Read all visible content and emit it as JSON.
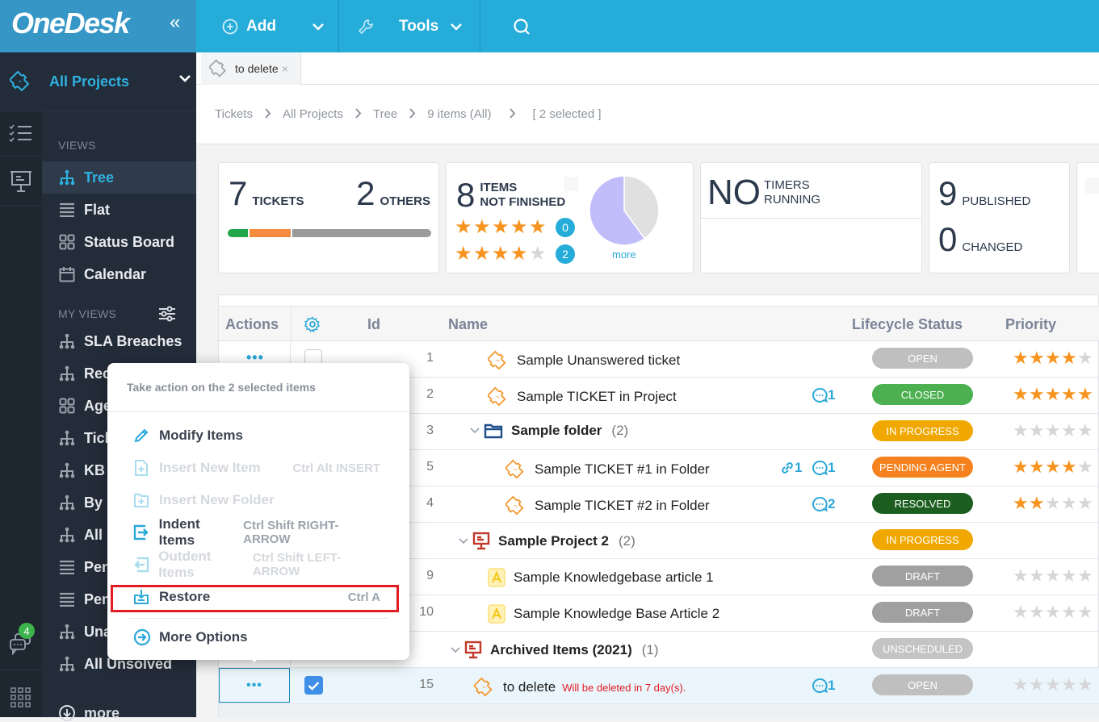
{
  "app": {
    "logo": "OneDesk",
    "collapse_icon": "«"
  },
  "toolbar": {
    "add_label": "Add",
    "tools_label": "Tools"
  },
  "rail": {
    "chat_badge": "4"
  },
  "sidebar": {
    "project": "All Projects",
    "views_label": "VIEWS",
    "views": [
      {
        "label": "Tree",
        "icon": "tree-icon",
        "active": true
      },
      {
        "label": "Flat",
        "icon": "list-icon"
      },
      {
        "label": "Status Board",
        "icon": "board-icon"
      },
      {
        "label": "Calendar",
        "icon": "calendar-icon"
      }
    ],
    "my_views_label": "MY VIEWS",
    "my_views": [
      {
        "label": "SLA Breaches",
        "icon": "tree-icon"
      },
      {
        "label": "Rec",
        "icon": "tree-icon"
      },
      {
        "label": "Age",
        "icon": "board-icon"
      },
      {
        "label": "Tick",
        "icon": "tree-icon"
      },
      {
        "label": "KB",
        "icon": "tree-icon"
      },
      {
        "label": "By I",
        "icon": "tree-icon"
      },
      {
        "label": "All I",
        "icon": "tree-icon"
      },
      {
        "label": "Pen",
        "icon": "list-icon"
      },
      {
        "label": "Pen",
        "icon": "list-icon"
      },
      {
        "label": "Una",
        "icon": "tree-icon"
      },
      {
        "label": "All Unsolved",
        "icon": "tree-icon"
      }
    ],
    "more_label": "more"
  },
  "tab": {
    "label": "to delete",
    "close": "×"
  },
  "breadcrumb": [
    "Tickets",
    "All Projects",
    "Tree",
    "9 items (All)",
    "[ 2 selected ]"
  ],
  "cards": {
    "tickets": {
      "count": "7",
      "label": "TICKETS",
      "others_count": "2",
      "others_label": "OTHERS"
    },
    "progress": {
      "green": 0.1,
      "orange": 0.21,
      "gray": 0.69
    },
    "not_finished": {
      "count": "8",
      "line1": "ITEMS",
      "line2": "NOT FINISHED",
      "five_star_count": "0",
      "four_star_count": "2",
      "more_label": "more",
      "pie": {
        "purple": 0.6,
        "gray": 0.4
      }
    },
    "timers": {
      "big": "NO",
      "line1": "TIMERS",
      "line2": "RUNNING"
    },
    "publish": {
      "published_count": "9",
      "published_label": "PUBLISHED",
      "changed_count": "0",
      "changed_label": "CHANGED"
    }
  },
  "grid": {
    "headers": {
      "actions": "Actions",
      "id": "Id",
      "name": "Name",
      "status": "Lifecycle Status",
      "priority": "Priority"
    },
    "rows": [
      {
        "id": "1",
        "name": "Sample Unanswered ticket",
        "type": "ticket",
        "indent": 0,
        "status": "OPEN",
        "status_color": "#bfbfbf",
        "stars": 4,
        "comments": ""
      },
      {
        "id": "2",
        "name": "Sample TICKET in Project",
        "type": "ticket",
        "indent": 0,
        "status": "CLOSED",
        "status_color": "#4caf50",
        "stars": 5,
        "comments": "1"
      },
      {
        "id": "3",
        "name": "Sample folder",
        "count": "(2)",
        "type": "folder",
        "indent": 0,
        "status": "IN PROGRESS",
        "status_color": "#f0a800",
        "stars": 0,
        "comments": ""
      },
      {
        "id": "5",
        "name": "Sample TICKET #1 in Folder",
        "type": "ticket",
        "indent": 1,
        "status": "PENDING AGENT",
        "status_color": "#f5821f",
        "stars": 4,
        "links": "1",
        "comments": "1"
      },
      {
        "id": "4",
        "name": "Sample TICKET #2 in Folder",
        "type": "ticket",
        "indent": 1,
        "status": "RESOLVED",
        "status_color": "#1b5e20",
        "stars": 2,
        "comments": "2"
      },
      {
        "id": "",
        "name": "Sample Project 2",
        "count": "(2)",
        "type": "project",
        "indent": 0,
        "status": "IN PROGRESS",
        "status_color": "#f0a800",
        "stars": null,
        "comments": ""
      },
      {
        "id": "9",
        "name": "Sample Knowledgebase article 1",
        "type": "article",
        "indent": 0,
        "status": "DRAFT",
        "status_color": "#a0a0a0",
        "stars": 0,
        "comments": ""
      },
      {
        "id": "10",
        "name": "Sample Knowledge Base Article 2",
        "type": "article",
        "indent": 0,
        "status": "DRAFT",
        "status_color": "#a0a0a0",
        "stars": 0,
        "comments": ""
      },
      {
        "id": "",
        "name": "Archived Items (2021)",
        "count": "(1)",
        "type": "project",
        "indent": -1,
        "status": "UNSCHEDULED",
        "status_color": "#c4c4c4",
        "stars": null,
        "comments": ""
      },
      {
        "id": "15",
        "name": "to delete",
        "warning": "Will be deleted in 7 day(s).",
        "type": "ticket",
        "indent": -1,
        "status": "OPEN",
        "status_color": "#bfbfbf",
        "stars": 0,
        "comments": "1",
        "selected": true,
        "checked": true
      }
    ]
  },
  "popup": {
    "title": "Take action on the 2 selected items",
    "items": [
      {
        "label": "Modify Items",
        "shortcut": "",
        "disabled": false,
        "icon": "pencil-icon"
      },
      {
        "label": "Insert New Item",
        "shortcut": "Ctrl Alt INSERT",
        "disabled": true,
        "icon": "insert-item-icon"
      },
      {
        "label": "Insert New Folder",
        "shortcut": "",
        "disabled": true,
        "icon": "insert-folder-icon"
      },
      {
        "label": "Indent Items",
        "shortcut": "Ctrl Shift RIGHT-ARROW",
        "disabled": false,
        "icon": "indent-icon"
      },
      {
        "label": "Outdent Items",
        "shortcut": "Ctrl Shift LEFT-ARROW",
        "disabled": true,
        "icon": "outdent-icon"
      },
      {
        "label": "Restore",
        "shortcut": "Ctrl A",
        "disabled": false,
        "icon": "restore-icon",
        "highlighted": true
      },
      {
        "label": "More Options",
        "shortcut": "",
        "disabled": false,
        "icon": "more-options-icon"
      }
    ]
  },
  "colors": {
    "accent": "#25acd9",
    "star_on": "#f7931e",
    "star_off": "#d6d6d6",
    "warning": "#e31b23"
  }
}
